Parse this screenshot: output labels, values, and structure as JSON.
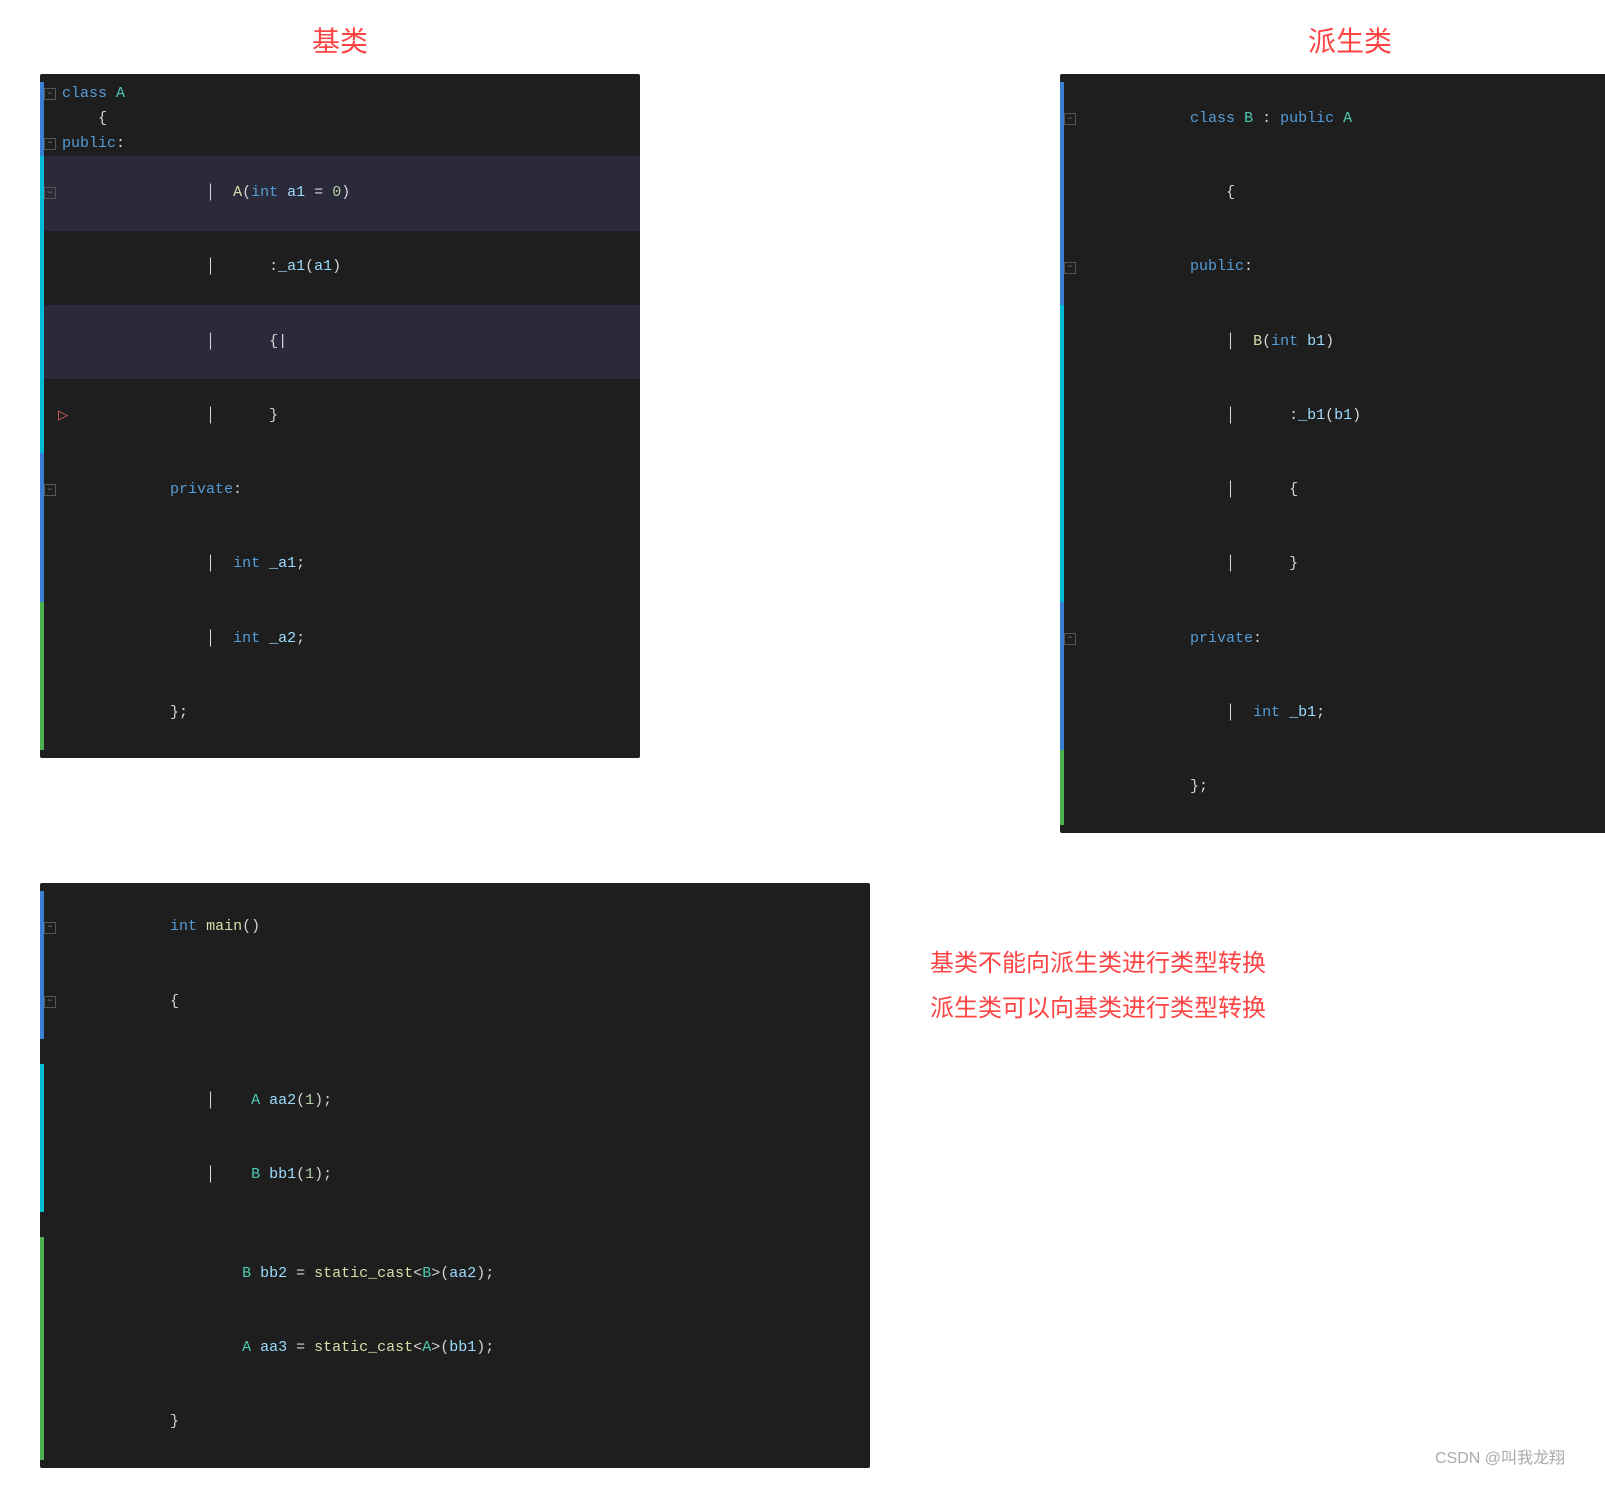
{
  "titles": {
    "base_class": "基类",
    "derived_class": "派生类"
  },
  "annotations": {
    "line1": "基类不能向派生类进行类型转换",
    "line2": "派生类可以向基类进行类型转换"
  },
  "watermark": "CSDN @叫我龙翔",
  "base_code": [
    {
      "indent": 0,
      "content": "class A",
      "has_fold": true,
      "strip": "blue",
      "bracket": false
    },
    {
      "indent": 1,
      "content": "{",
      "has_fold": false,
      "strip": "blue",
      "bracket": false
    },
    {
      "indent": 1,
      "content": "public:",
      "has_fold": true,
      "strip": "blue",
      "bracket": false
    },
    {
      "indent": 1,
      "content": "A(int a1 = 0)",
      "has_fold": true,
      "strip": "cyan",
      "bracket": true,
      "highlighted": true
    },
    {
      "indent": 2,
      "content": ":_a1(a1)",
      "has_fold": false,
      "strip": "cyan",
      "bracket": true
    },
    {
      "indent": 2,
      "content": "{|",
      "has_fold": false,
      "strip": "cyan",
      "bracket": true,
      "highlighted": true
    },
    {
      "indent": 2,
      "content": "}",
      "has_fold": false,
      "strip": "cyan",
      "bracket": true,
      "has_arrow": true
    },
    {
      "indent": 1,
      "content": "private:",
      "has_fold": true,
      "strip": "blue",
      "bracket": false
    },
    {
      "indent": 2,
      "content": "int _a1;",
      "has_fold": false,
      "strip": "blue",
      "bracket": false
    },
    {
      "indent": 2,
      "content": "int _a2;",
      "has_fold": false,
      "strip": "green",
      "bracket": false
    },
    {
      "indent": 0,
      "content": "};",
      "has_fold": false,
      "strip": "green",
      "bracket": false
    }
  ],
  "derived_code": [
    {
      "indent": 0,
      "content": "class B : public A",
      "has_fold": true,
      "strip": "blue"
    },
    {
      "indent": 1,
      "content": "{",
      "strip": "blue"
    },
    {
      "indent": 1,
      "content": "public:",
      "has_fold": true,
      "strip": "blue"
    },
    {
      "indent": 1,
      "content": "B(int b1)",
      "has_fold": false,
      "strip": "cyan",
      "bracket": true
    },
    {
      "indent": 2,
      "content": ":_b1(b1)",
      "strip": "cyan",
      "bracket": true
    },
    {
      "indent": 2,
      "content": "{",
      "strip": "cyan",
      "bracket": true
    },
    {
      "indent": 2,
      "content": "}",
      "strip": "cyan",
      "bracket": true
    },
    {
      "indent": 1,
      "content": "private:",
      "has_fold": true,
      "strip": "blue"
    },
    {
      "indent": 1,
      "content": "int _b1;",
      "strip": "blue"
    },
    {
      "indent": 0,
      "content": "};",
      "strip": "green"
    }
  ],
  "main_code": [
    {
      "content": "int main()",
      "fold": true,
      "strip": "blue"
    },
    {
      "content": "{",
      "fold": true,
      "strip": "blue"
    },
    {
      "content": "",
      "strip": "empty"
    },
    {
      "content": "    A aa2(1);",
      "strip": "cyan",
      "bracket": true
    },
    {
      "content": "    B bb1(1);",
      "strip": "cyan",
      "bracket": true
    },
    {
      "content": "",
      "strip": "empty"
    },
    {
      "content": "    B bb2 = static_cast<B>(aa2);",
      "strip": "green",
      "bracket": false
    },
    {
      "content": "    A aa3 = static_cast<A>(bb1);",
      "strip": "green",
      "bracket": false
    },
    {
      "content": "}",
      "strip": "green"
    }
  ]
}
